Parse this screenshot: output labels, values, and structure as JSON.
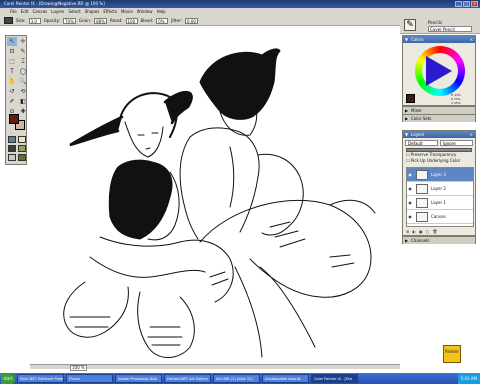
{
  "window": {
    "title": "Corel Painter IX - [Drawing/Negative.RIF @ 100 %]",
    "controls": [
      "_",
      "□",
      "×"
    ]
  },
  "menu": [
    "File",
    "Edit",
    "Canvas",
    "Layers",
    "Select",
    "Shapes",
    "Effects",
    "Movie",
    "Window",
    "Help"
  ],
  "propbar": {
    "size_label": "Size:",
    "size_value": "3.0",
    "opacity_label": "Opacity:",
    "opacity_value": "70%",
    "grain_label": "Grain:",
    "grain_value": "88%",
    "resat_label": "Resat:",
    "resat_value": "100",
    "bleed_label": "Bleed:",
    "bleed_value": "0%",
    "jitter_label": "Jitter:",
    "jitter_value": "0.00"
  },
  "brush": {
    "category": "Pencils",
    "variant": "Cover Pencil"
  },
  "toolbox": {
    "tools": [
      "↖",
      "✛",
      "⊡",
      "✎",
      "⬚",
      "⌶",
      "T",
      "◯",
      "✋",
      "🔍",
      "↺",
      "⟲",
      "✐",
      "◧",
      "⊙",
      "✚"
    ]
  },
  "canvas": {
    "zoom": "100 %"
  },
  "panels": {
    "colors": {
      "title": "Colors",
      "current_color": "#3c1c14",
      "hsv": [
        "H 13%",
        "S 73%",
        "V 25%"
      ]
    },
    "mixer": {
      "title": "Mixer"
    },
    "color_sets": {
      "title": "Color Sets"
    },
    "layers": {
      "title": "Layers",
      "composite": "Default",
      "ignore": "Ignore",
      "opacity": "100 %",
      "preserve_transparency": "Preserve Transparency",
      "pick_up_color": "Pick Up Underlying Color",
      "items": [
        {
          "name": "Layer 3",
          "active": true
        },
        {
          "name": "Layer 2",
          "active": false
        },
        {
          "name": "Layer 1",
          "active": false
        },
        {
          "name": "Canvas",
          "active": false
        }
      ]
    },
    "channels": {
      "title": "Channels"
    }
  },
  "logo_text": "Painter",
  "taskbar": {
    "start": "start",
    "tasks": [
      "Paint.NET Software Produ",
      "ITunes",
      "Adobe Photoshop Disk",
      "DeviantART: Art Gallery",
      "dA+ARt (2) [dArt 12]",
      "Unstoppable Awards",
      "Corel Painter IX - [Dra"
    ],
    "clock": "5:03 AM"
  }
}
